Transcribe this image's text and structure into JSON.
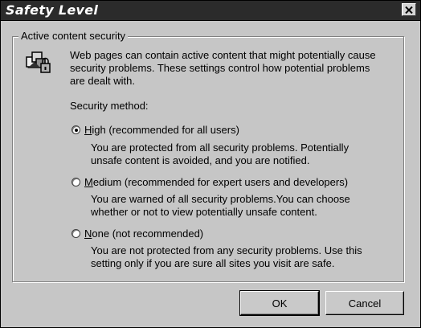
{
  "window": {
    "title": "Safety Level",
    "close_glyph": "×"
  },
  "group": {
    "label": "Active content security",
    "icon": "security-shield-icon",
    "description": [
      "Web pages can contain active content that might potentially cause",
      "security problems. These settings control how potential problems",
      "are dealt with."
    ],
    "method_label": "Security method:"
  },
  "options": [
    {
      "accel": "H",
      "label_rest": "igh (recommended for all users)",
      "selected": true,
      "description": [
        "You are protected from all security problems. Potentially",
        "unsafe content is avoided, and you are notified."
      ]
    },
    {
      "accel": "M",
      "label_rest": "edium (recommended for expert users and developers)",
      "selected": false,
      "description": [
        "You are warned of all security problems.You can choose",
        "whether or not to view potentially unsafe content."
      ]
    },
    {
      "accel": "N",
      "label_rest": "one  (not recommended)",
      "selected": false,
      "description": [
        "You are not protected from any security problems. Use this",
        "setting only if you are sure all sites you visit are safe."
      ]
    }
  ],
  "buttons": {
    "ok": "OK",
    "cancel": "Cancel"
  }
}
